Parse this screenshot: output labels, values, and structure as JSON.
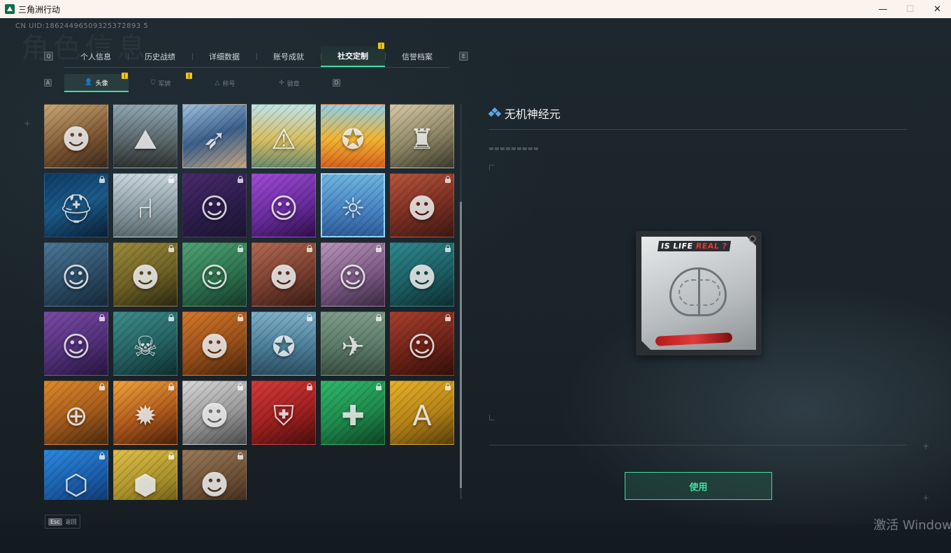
{
  "window": {
    "title": "三角洲行动",
    "minimize_label": "—",
    "maximize_label": "☐",
    "close_label": "✕"
  },
  "header": {
    "uid": "CN UID:18624496509325372893 5",
    "bg_title": "角色信息"
  },
  "main_tabs": {
    "prev_key": "Q",
    "next_key": "E",
    "items": [
      {
        "label": "个人信息"
      },
      {
        "label": "历史战绩"
      },
      {
        "label": "详细数据"
      },
      {
        "label": "账号成就"
      },
      {
        "label": "社交定制",
        "active": true,
        "badge": true
      },
      {
        "label": "信誉档案"
      }
    ]
  },
  "sub_tabs": {
    "prev_key": "A",
    "next_key": "D",
    "items": [
      {
        "label": "头像",
        "icon": "person-icon",
        "glyph": "👤",
        "active": true,
        "badge": true
      },
      {
        "label": "军牌",
        "icon": "tag-icon",
        "glyph": "⛉",
        "badge": true
      },
      {
        "label": "称号",
        "icon": "title-icon",
        "glyph": "△"
      },
      {
        "label": "徽章",
        "icon": "badge-icon",
        "glyph": "✢"
      }
    ]
  },
  "avatars": [
    {
      "name": "soldier-rifle",
      "bg": "linear-gradient(160deg,#c9a874,#7a5230 60%,#3a2b1e)",
      "glyph": "☻",
      "locked": false
    },
    {
      "name": "cliff-lookout",
      "bg": "linear-gradient(180deg,#8fa7b3,#5d6a6e 55%,#2f3330)",
      "glyph": "⛰",
      "locked": false
    },
    {
      "name": "archer",
      "bg": "linear-gradient(160deg,#9ec3e0,#3b5f8a 50%,#c7a783)",
      "glyph": "➶",
      "locked": false
    },
    {
      "name": "alligator-sign",
      "bg": "linear-gradient(180deg,#bfe3ea,#d9c062 55%,#6a8a6f)",
      "glyph": "⚠",
      "locked": false
    },
    {
      "name": "cartoon-fox",
      "bg": "linear-gradient(180deg,#8fd0e8,#f3b431 55%,#d7621e)",
      "glyph": "✪",
      "locked": false
    },
    {
      "name": "soldier-backpack",
      "bg": "linear-gradient(160deg,#d8c9a5,#8c8565 55%,#3b3a2c)",
      "glyph": "♜",
      "locked": false
    },
    {
      "name": "blue-helmet",
      "bg": "linear-gradient(160deg,#0d3b66,#1c5a8a 50%,#0a1f33)",
      "glyph": "⛑",
      "locked": true
    },
    {
      "name": "white-chair",
      "bg": "linear-gradient(180deg,#c9d6dd,#8e9ea6 55%,#5b6b6b)",
      "glyph": "⑁",
      "locked": true
    },
    {
      "name": "glasses-man",
      "bg": "linear-gradient(160deg,#4a2a6b,#2b1c4a 60%,#1b1630)",
      "glyph": "☺",
      "locked": true
    },
    {
      "name": "purple-girl",
      "bg": "linear-gradient(160deg,#a24ad6,#6a2d9f 55%,#2f0f4a)",
      "glyph": "☺",
      "locked": false
    },
    {
      "name": "aztec-mascot",
      "bg": "linear-gradient(180deg,#6fb5e0,#4a86c5 55%,#2e5d9a)",
      "glyph": "☼",
      "locked": false,
      "selected": true
    },
    {
      "name": "bearded-cap",
      "bg": "linear-gradient(160deg,#b7563d,#7b2f22 55%,#3a1a14)",
      "glyph": "☻",
      "locked": true
    },
    {
      "name": "pilot-goggles",
      "bg": "linear-gradient(160deg,#4b7898,#2d4d66 55%,#16293a)",
      "glyph": "☺",
      "locked": false
    },
    {
      "name": "bald-headset",
      "bg": "linear-gradient(160deg,#9b8a3a,#6e6125 55%,#2c2812)",
      "glyph": "☻",
      "locked": true
    },
    {
      "name": "green-headset",
      "bg": "linear-gradient(160deg,#4fa374,#2e7450 55%,#173b28)",
      "glyph": "☺",
      "locked": true
    },
    {
      "name": "helmet-soldier",
      "bg": "linear-gradient(160deg,#b26a52,#7a3f30 55%,#3a1c14)",
      "glyph": "☻",
      "locked": true
    },
    {
      "name": "white-hair",
      "bg": "linear-gradient(160deg,#b794b8,#7e5b86 55%,#3b2a44)",
      "glyph": "☺",
      "locked": true
    },
    {
      "name": "teal-beard",
      "bg": "linear-gradient(160deg,#2f8a8e,#1c5e63 55%,#0d2f33)",
      "glyph": "☻",
      "locked": true
    },
    {
      "name": "purple-bob",
      "bg": "linear-gradient(160deg,#7b4aa6,#52307a 55%,#27163d)",
      "glyph": "☺",
      "locked": true
    },
    {
      "name": "gas-mask",
      "bg": "linear-gradient(160deg,#3f8d8d,#256262 55%,#0f2e2e)",
      "glyph": "☠",
      "locked": true
    },
    {
      "name": "hooded-mask",
      "bg": "linear-gradient(160deg,#d5772a,#99501a 55%,#4a250c)",
      "glyph": "☻",
      "locked": true
    },
    {
      "name": "star-emblem",
      "bg": "linear-gradient(180deg,#7fb0c8,#4b7f99 55%,#2d4f62)",
      "glyph": "✪",
      "locked": true
    },
    {
      "name": "helicopter-field",
      "bg": "linear-gradient(180deg,#7f9c88,#5c7a68 55%,#3a4f42)",
      "glyph": "✈",
      "locked": true
    },
    {
      "name": "red-hair",
      "bg": "linear-gradient(160deg,#a9402e,#6f2318 55%,#32100a)",
      "glyph": "☺",
      "locked": true
    },
    {
      "name": "eri-logo",
      "bg": "linear-gradient(160deg,#e08a2a,#a45b1c 55%,#4a2a0e)",
      "glyph": "⊕",
      "locked": true
    },
    {
      "name": "explosion",
      "bg": "linear-gradient(160deg,#f0a43a,#b05a1c 55%,#4a200a)",
      "glyph": "✹",
      "locked": true
    },
    {
      "name": "gunman-sketch",
      "bg": "linear-gradient(160deg,#d8d8d8,#9a9a9a 55%,#4a4a4a)",
      "glyph": "☻",
      "locked": true
    },
    {
      "name": "red-shield",
      "bg": "linear-gradient(160deg,#d63a3a,#a02020 55%,#4a0e0e)",
      "glyph": "⛨",
      "locked": true
    },
    {
      "name": "green-cross",
      "bg": "linear-gradient(160deg,#2fb86a,#1f8a4c 55%,#0e4424)",
      "glyph": "✚",
      "locked": true
    },
    {
      "name": "yellow-a",
      "bg": "linear-gradient(160deg,#e8b22a,#b58318 55%,#5a3f08)",
      "glyph": "A",
      "locked": true
    },
    {
      "name": "blue-hex",
      "bg": "linear-gradient(160deg,#2a8ae0,#1a5aa6 55%,#0c2c55)",
      "glyph": "⬡",
      "locked": true
    },
    {
      "name": "yellow-hex",
      "bg": "linear-gradient(160deg,#e0c04a,#a8902a 55%,#54480f)",
      "glyph": "⬢",
      "locked": true
    },
    {
      "name": "long-hair-man",
      "bg": "linear-gradient(160deg,#9a7a5a,#6a4e34 55%,#2e2014)",
      "glyph": "☻",
      "locked": true
    }
  ],
  "detail": {
    "title": "无机神经元",
    "preview_text_white": "IS LIFE ",
    "preview_text_red": "REAL ?",
    "use_button": "使用"
  },
  "footer": {
    "esc_key": "Esc",
    "esc_label": "返回",
    "os_watermark": "激活 Windows"
  },
  "colors": {
    "accent": "#3de0a0",
    "badge": "#f0c419",
    "title_icon": "#5aa7e6"
  }
}
